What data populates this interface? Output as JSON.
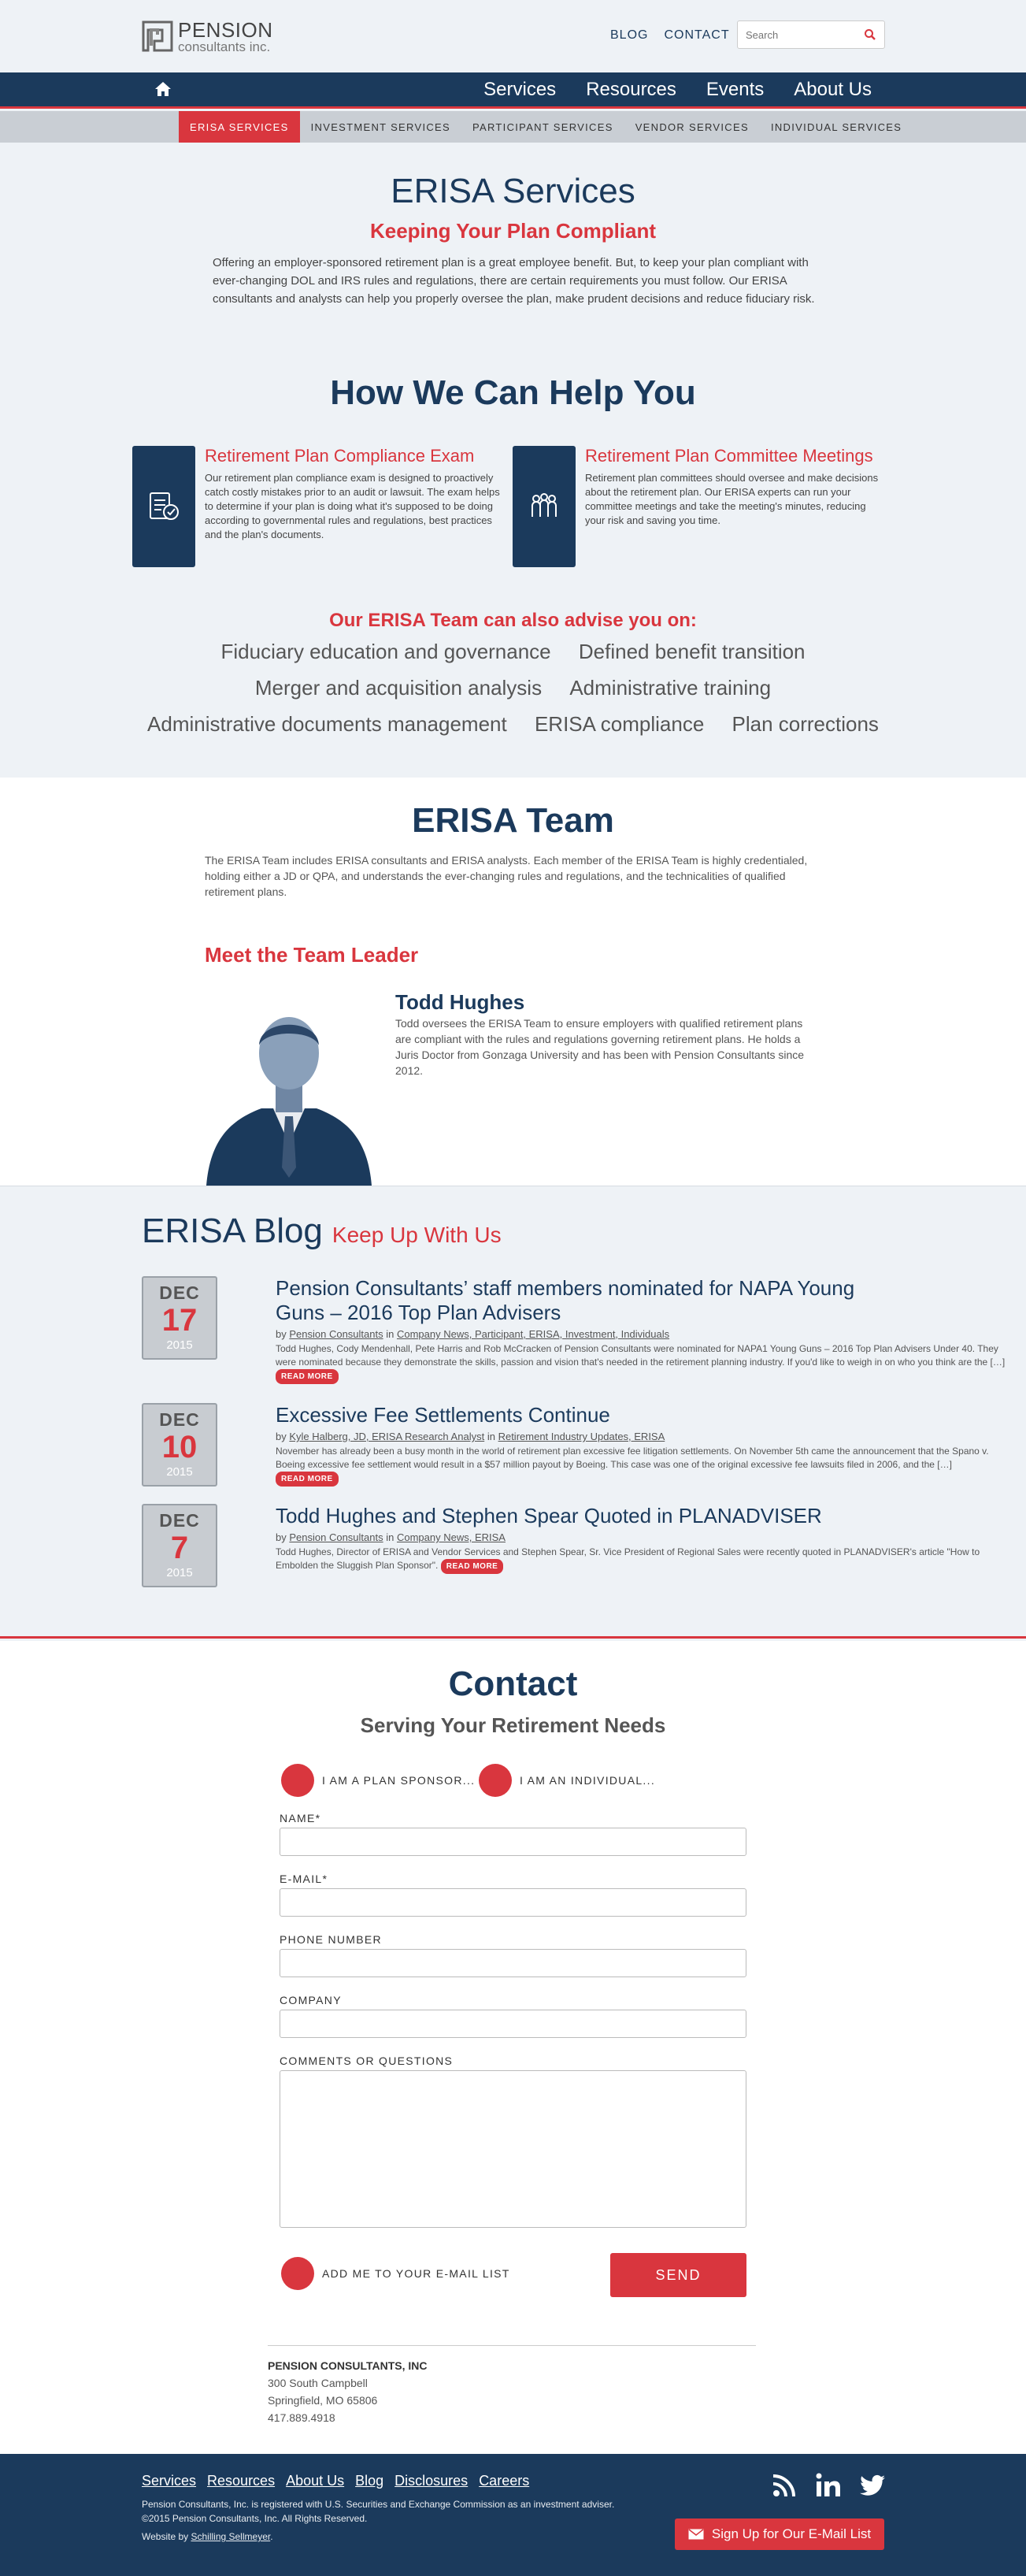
{
  "header": {
    "logo_line1": "PENSION",
    "logo_line2": "consultants inc.",
    "top_links": [
      "BLOG",
      "CONTACT"
    ],
    "search_placeholder": "Search"
  },
  "main_nav": [
    "Services",
    "Resources",
    "Events",
    "About Us"
  ],
  "sub_nav": [
    "ERISA SERVICES",
    "INVESTMENT SERVICES",
    "PARTICIPANT SERVICES",
    "VENDOR SERVICES",
    "INDIVIDUAL SERVICES"
  ],
  "intro": {
    "title": "ERISA Services",
    "subtitle": "Keeping Your Plan Compliant",
    "text": "Offering an employer-sponsored retirement plan is a great employee benefit. But, to keep your plan compliant with ever-changing DOL and IRS rules and regulations, there are certain requirements you must follow. Our ERISA consultants and analysts can help you properly oversee the plan, make prudent decisions and reduce fiduciary risk."
  },
  "help": {
    "title": "How We Can Help You",
    "cards": [
      {
        "title": "Retirement Plan Compliance Exam",
        "text": "Our retirement plan compliance exam is designed to proactively catch costly mistakes prior to an audit or lawsuit. The exam helps to determine if your plan is doing what it's supposed to be doing according to governmental rules and regulations, best practices and the plan's documents."
      },
      {
        "title": "Retirement Plan Committee Meetings",
        "text": "Retirement plan committees should oversee and make decisions about the retirement plan. Our ERISA experts can run your committee meetings and take the meeting's minutes, reducing your risk and saving you time."
      }
    ]
  },
  "advise": {
    "title": "Our ERISA Team can also advise you on:",
    "lines": [
      [
        "Fiduciary education and governance",
        "Defined benefit transition"
      ],
      [
        "Merger and acquisition analysis",
        "Administrative training"
      ],
      [
        "Administrative documents management",
        "ERISA compliance",
        "Plan corrections"
      ]
    ]
  },
  "team": {
    "title": "ERISA Team",
    "text": "The ERISA Team includes ERISA consultants and ERISA analysts. Each member of the ERISA Team is highly credentialed, holding either a JD or QPA, and understands the ever-changing rules and regulations, and the technicalities of qualified retirement plans.",
    "leader_title": "Meet the Team Leader",
    "leader_name": "Todd Hughes",
    "leader_bio": "Todd oversees the ERISA Team to ensure employers with qualified retirement plans are compliant with the rules and regulations governing retirement plans. He holds a Juris Doctor from Gonzaga University and has been with Pension Consultants since 2012."
  },
  "blog": {
    "title": "ERISA Blog",
    "subtitle": "Keep Up With Us",
    "read_more": "READ MORE",
    "posts": [
      {
        "month": "DEC",
        "day": "17",
        "year": "2015",
        "title": "Pension Consultants’ staff members nominated for NAPA Young Guns – 2016 Top Plan Advisers",
        "by": "by",
        "author": "Pension Consultants",
        "in": "in",
        "categories": "Company News, Participant, ERISA, Investment, Individuals",
        "excerpt": "Todd Hughes, Cody Mendenhall, Pete Harris and Rob McCracken of Pension Consultants were nominated for NAPA1 Young Guns – 2016 Top Plan Advisers Under 40. They were nominated because they demonstrate the skills, passion and vision that's needed in the retirement planning industry. If you'd like to weigh in on who you think are the […]"
      },
      {
        "month": "DEC",
        "day": "10",
        "year": "2015",
        "title": "Excessive Fee Settlements Continue",
        "by": "by",
        "author": "Kyle Halberg, JD, ERISA Research Analyst",
        "in": "in",
        "categories": "Retirement Industry Updates, ERISA",
        "excerpt": "November has already been a busy month in the world of retirement plan excessive fee litigation settlements. On November 5th came the announcement that the Spano v. Boeing excessive fee settlement would result in a $57 million payout by Boeing. This case was one of the original excessive fee lawsuits filed in 2006, and the […]"
      },
      {
        "month": "DEC",
        "day": "7",
        "year": "2015",
        "title": "Todd Hughes and Stephen Spear Quoted in PLANADVISER",
        "by": "by",
        "author": "Pension Consultants",
        "in": "in",
        "categories": "Company News, ERISA",
        "excerpt": "Todd Hughes, Director of ERISA and Vendor Services and Stephen Spear, Sr. Vice President of Regional Sales were recently quoted in PLANADVISER's article \"How to Embolden the Sluggish Plan Sponsor\"."
      }
    ]
  },
  "contact": {
    "title": "Contact",
    "subtitle": "Serving Your Retirement Needs",
    "radio_sponsor": "I AM A PLAN SPONSOR...",
    "radio_individual": "I AM AN INDIVIDUAL...",
    "name_label": "NAME*",
    "email_label": "E-MAIL*",
    "phone_label": "PHONE NUMBER",
    "company_label": "COMPANY",
    "comments_label": "COMMENTS OR QUESTIONS",
    "email_list_label": "ADD ME TO YOUR E-MAIL LIST",
    "send_label": "SEND"
  },
  "address": {
    "company": "PENSION CONSULTANTS, INC",
    "street": "300 South Campbell",
    "city": "Springfield, MO 65806",
    "phone": "417.889.4918"
  },
  "footer": {
    "links": [
      "Services",
      "Resources",
      "About Us",
      "Blog",
      "Disclosures",
      "Careers"
    ],
    "legal": "Pension Consultants, Inc. is registered with U.S. Securities and Exchange Commission as an investment adviser. ©2015 Pension Consultants, Inc. All Rights Reserved.",
    "credit_prefix": "Website by",
    "credit_link": "Schilling Sellmeyer",
    "credit_suffix": ".",
    "signup_label": "Sign Up for Our E-Mail List"
  },
  "colors": {
    "navy": "#1b3a5c",
    "red": "#d9363e",
    "light_bg": "#eef2f6"
  }
}
